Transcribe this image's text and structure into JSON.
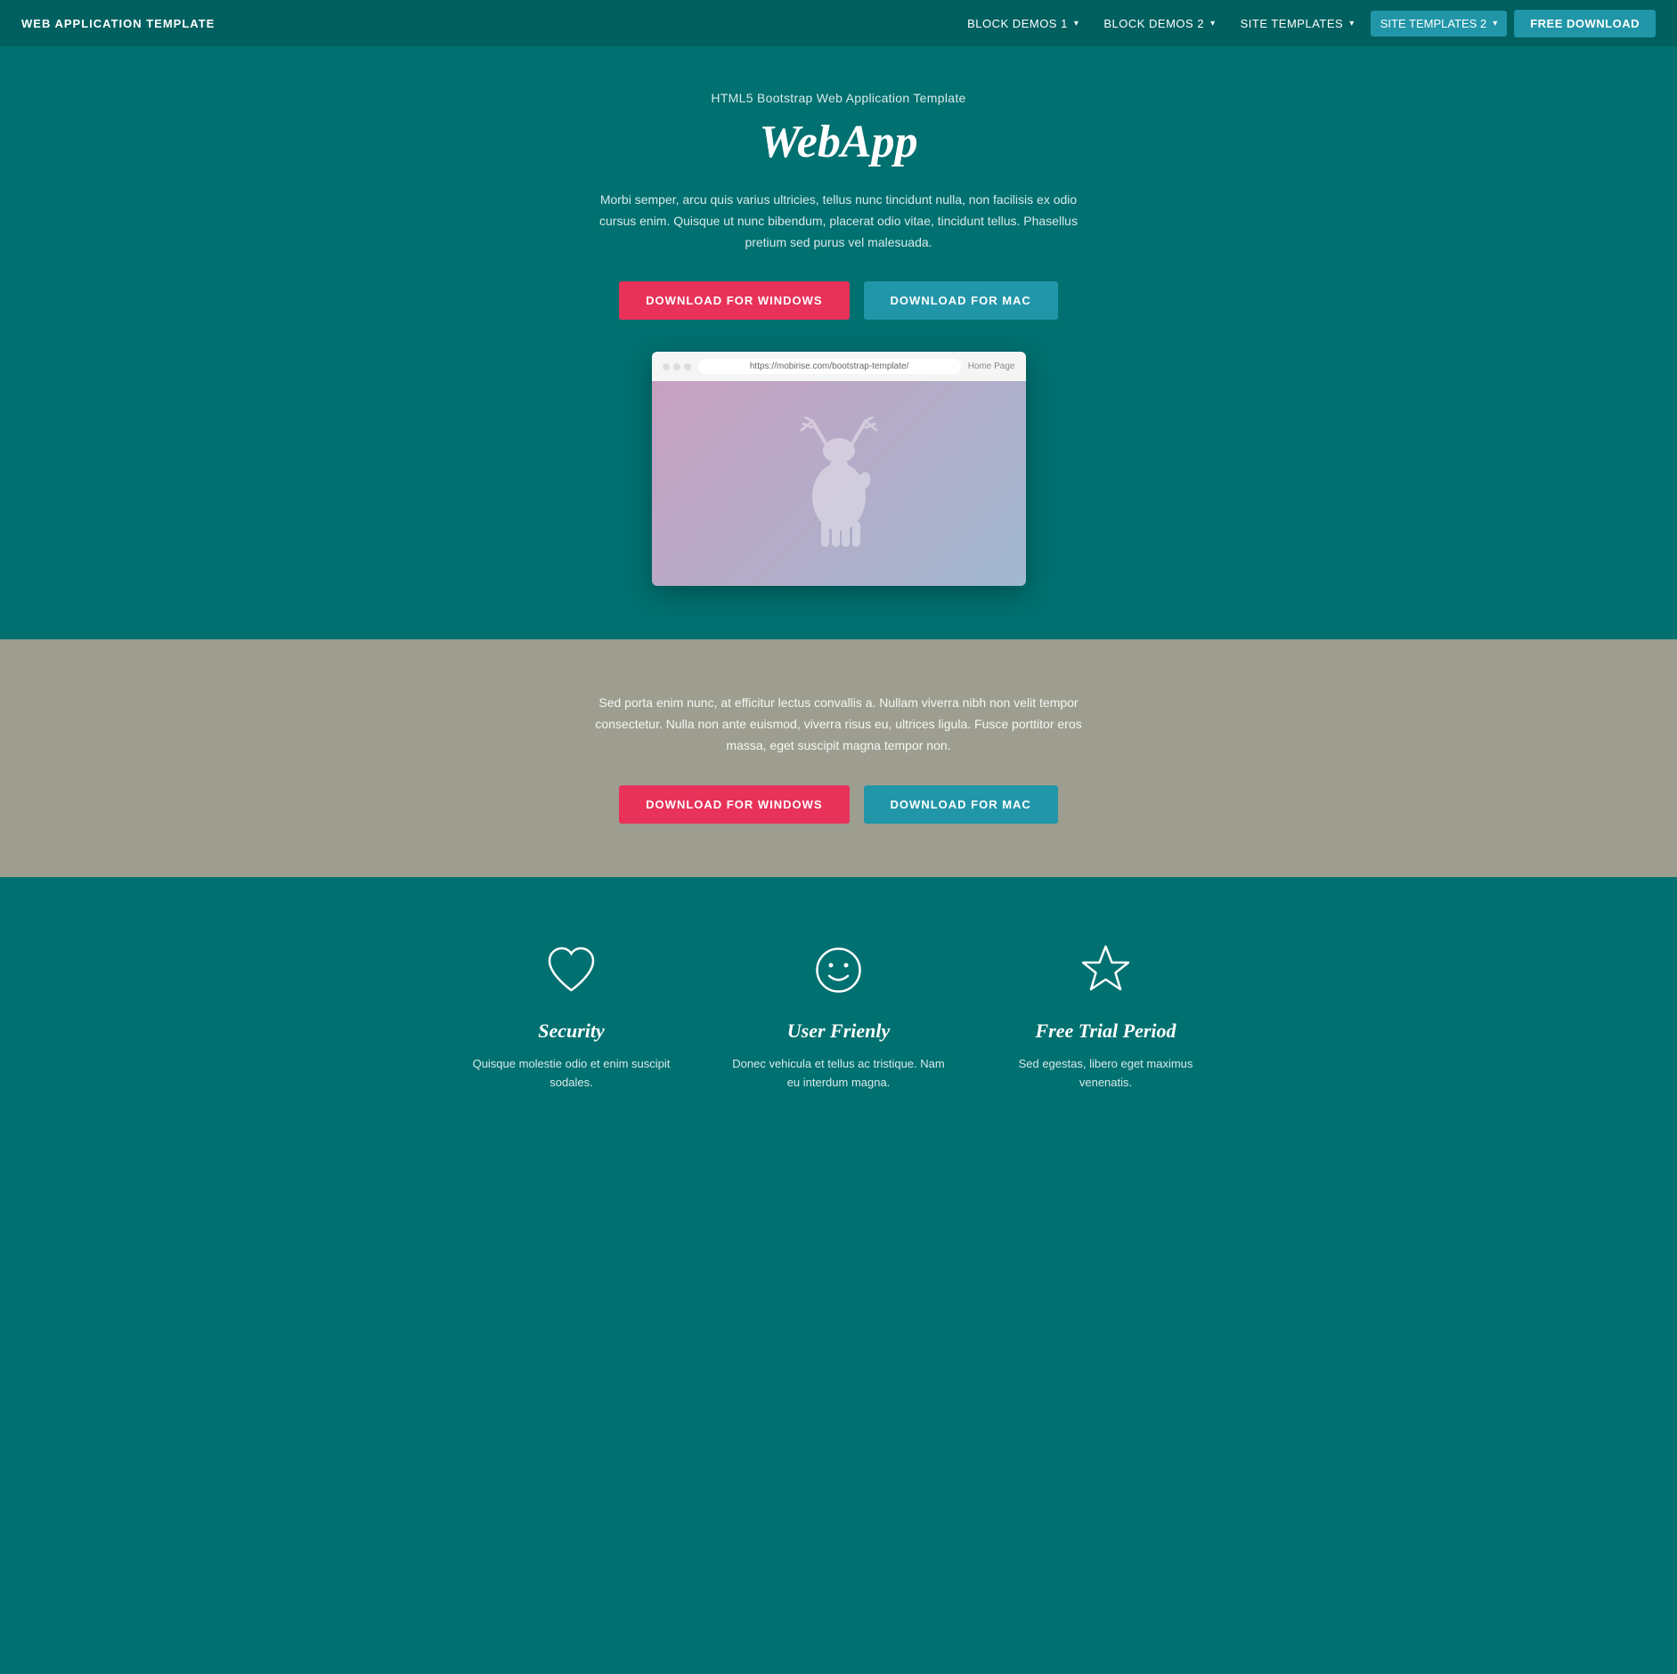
{
  "navbar": {
    "brand": "WEB APPLICATION TEMPLATE",
    "menu": {
      "block_demos_1": "BLOCK DEMOS 1",
      "block_demos_2": "BLOCK DEMOS 2",
      "site_templates": "SITE TEMPLATES",
      "site_templates_active": "SITE TEMPLATES 2"
    },
    "free_download": "FREE DOWNLOAD"
  },
  "hero": {
    "subtitle": "HTML5 Bootstrap Web Application Template",
    "title": "WebApp",
    "description": "Morbi semper, arcu quis varius ultricies, tellus nunc tincidunt nulla, non facilisis ex odio cursus enim. Quisque ut nunc bibendum, placerat odio vitae, tincidunt tellus. Phasellus pretium sed purus vel malesuada.",
    "btn_windows": "DOWNLOAD FOR WINDOWS",
    "btn_mac": "DOWNLOAD FOR MAC",
    "browser_url": "https://mobirise.com/bootstrap-template/",
    "browser_home": "Home Page"
  },
  "gray_section": {
    "description": "Sed porta enim nunc, at efficitur lectus convallis a. Nullam viverra nibh non velit tempor consectetur. Nulla non ante euismod, viverra risus eu, ultrices ligula. Fusce porttitor eros massa, eget suscipit magna tempor non.",
    "btn_windows": "DOWNLOAD FOR WINDOWS",
    "btn_mac": "DOWNLOAD FOR MAC"
  },
  "features": {
    "items": [
      {
        "icon": "heart",
        "title": "Security",
        "description": "Quisque molestie odio et enim suscipit sodales."
      },
      {
        "icon": "smiley",
        "title": "User Frienly",
        "description": "Donec vehicula et tellus ac tristique. Nam eu interdum magna."
      },
      {
        "icon": "star",
        "title": "Free Trial Period",
        "description": "Sed egestas, libero eget maximus venenatis."
      }
    ]
  }
}
